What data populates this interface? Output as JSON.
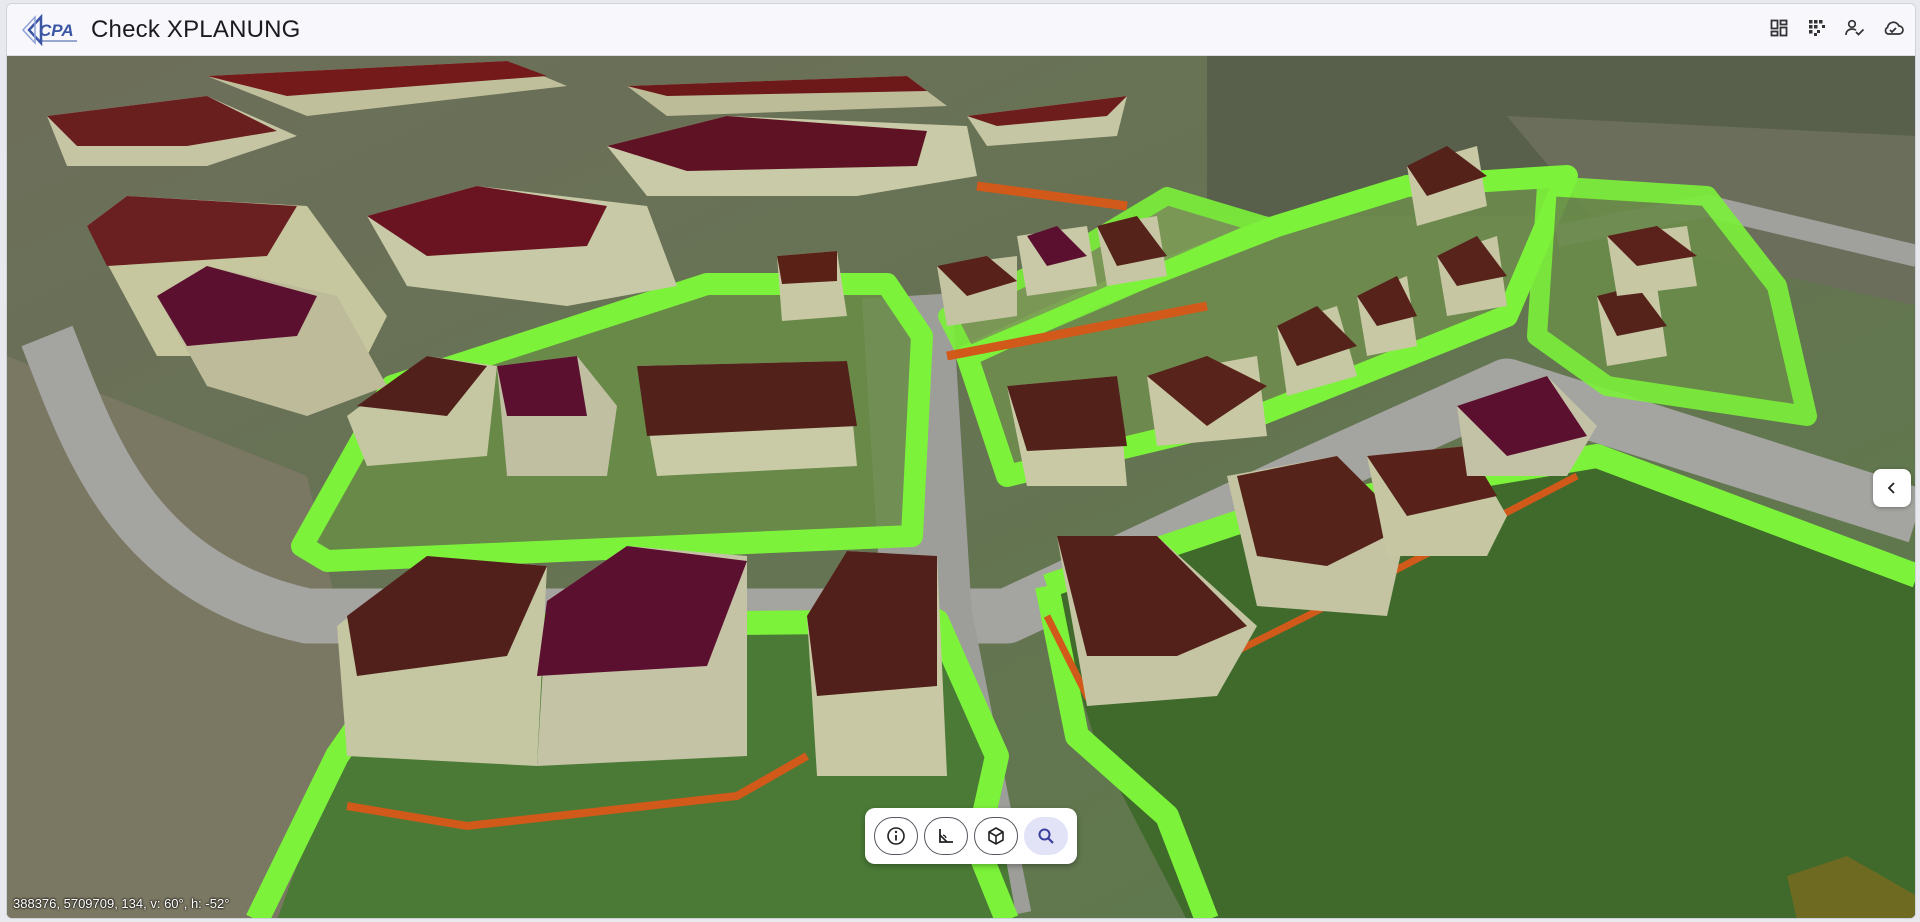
{
  "app": {
    "title": "Check XPLANUNG",
    "logo_text": "CPA"
  },
  "header_actions": [
    {
      "name": "layout-grid-icon",
      "tooltip": ""
    },
    {
      "name": "grid-dots-icon",
      "tooltip": ""
    },
    {
      "name": "user-check-icon",
      "tooltip": ""
    },
    {
      "name": "cloud-check-icon",
      "tooltip": ""
    }
  ],
  "toolbar": {
    "tools": [
      {
        "name": "info-icon",
        "active": false
      },
      {
        "name": "measure-icon",
        "active": false
      },
      {
        "name": "cube-icon",
        "active": false
      },
      {
        "name": "search-icon",
        "active": true
      }
    ]
  },
  "side_panel": {
    "toggle_icon": "chevron-left-icon"
  },
  "status": {
    "coordinates": "388376, 5709709, 134, v: 60°, h: -52°"
  },
  "colors": {
    "zone_outline": "#7cf23a",
    "roof": "#5a2015",
    "roof_purple": "#5c1030",
    "wall": "#c9cba8",
    "road": "#a9a9a6",
    "accent": "#4b4fc9",
    "border_orange": "#d15a1a"
  }
}
